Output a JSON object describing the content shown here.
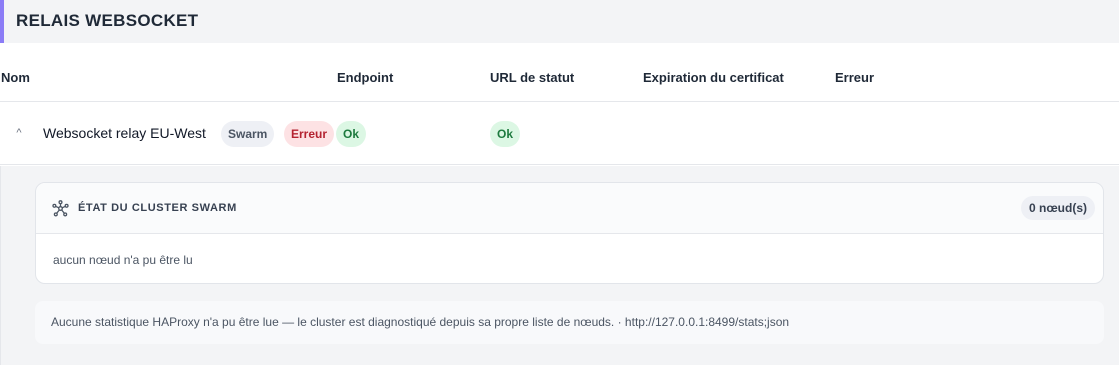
{
  "section": {
    "title": "RELAIS WEBSOCKET"
  },
  "table": {
    "columns": [
      "Nom",
      "Endpoint",
      "URL de statut",
      "Expiration du certificat",
      "Erreur"
    ]
  },
  "row": {
    "name": "Websocket relay EU-West",
    "badges": {
      "swarm": "Swarm",
      "error": "Erreur",
      "ok": "Ok"
    },
    "status_url": "Ok"
  },
  "cluster": {
    "icon": "cluster-nodes-icon",
    "title": "ÉTAT DU CLUSTER SWARM",
    "node_count": "0 nœud(s)",
    "message": "aucun nœud n'a pu être lu"
  },
  "note": {
    "text": "Aucune statistique HAProxy n'a pu être lue — le cluster est diagnostiqué depuis sa propre liste de nœuds. · http://127.0.0.1:8499/stats;json"
  },
  "colors": {
    "accent": "#8b7cf6",
    "error": "#b42331",
    "ok": "#1d7a3e"
  }
}
